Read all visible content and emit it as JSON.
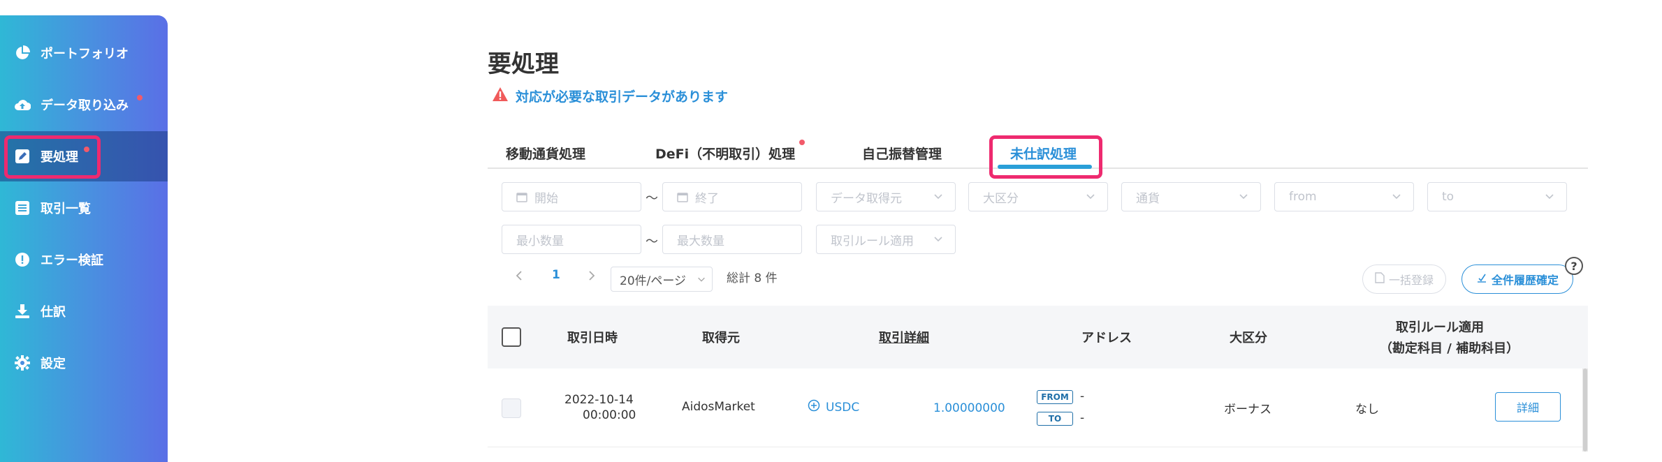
{
  "sidebar": {
    "items": [
      {
        "label": "ポートフォリオ",
        "icon": "pie-chart-icon"
      },
      {
        "label": "データ取り込み",
        "icon": "cloud-upload-icon",
        "dot": true
      },
      {
        "label": "要処理",
        "icon": "edit-icon",
        "dot": true,
        "active": true
      },
      {
        "label": "取引一覧",
        "icon": "list-icon"
      },
      {
        "label": "エラー検証",
        "icon": "alert-circle-icon"
      },
      {
        "label": "仕訳",
        "icon": "download-icon"
      },
      {
        "label": "設定",
        "icon": "gear-icon"
      }
    ]
  },
  "page": {
    "title": "要処理",
    "warning": "対応が必要な取引データがあります"
  },
  "tabs": [
    {
      "label": "移動通貨処理"
    },
    {
      "label": "DeFi（不明取引）処理",
      "dot": true
    },
    {
      "label": "自己振替管理"
    },
    {
      "label": "未仕訳処理",
      "active": true
    }
  ],
  "filters": {
    "start_placeholder": "開始",
    "tilde": "〜",
    "end_placeholder": "終了",
    "source_placeholder": "データ取得元",
    "category_placeholder": "大区分",
    "currency_placeholder": "通貨",
    "from_placeholder": "from",
    "to_placeholder": "to",
    "min_qty_placeholder": "最小数量",
    "max_qty_placeholder": "最大数量",
    "rule_placeholder": "取引ルール適用"
  },
  "pager": {
    "current_page": "1",
    "page_size": "20件/ページ",
    "total": "総計 8 件"
  },
  "actions": {
    "bulk_register": "一括登録",
    "confirm_all": "全件履歴確定",
    "help": "?"
  },
  "table": {
    "headers": {
      "datetime": "取引日時",
      "source": "取得元",
      "detail": "取引詳細",
      "address": "アドレス",
      "category": "大区分",
      "rule_line1": "取引ルール適用",
      "rule_line2": "（勘定科目 / 補助科目）"
    },
    "rows": [
      {
        "date": "2022-10-14",
        "time": "00:00:00",
        "source": "AidosMarket",
        "currency": "USDC",
        "amount": "1.00000000",
        "from_tag": "FROM",
        "from_value": "-",
        "to_tag": "TO",
        "to_value": "-",
        "category": "ボーナス",
        "rule": "なし",
        "detail_button": "詳細"
      }
    ]
  },
  "colors": {
    "accent": "#2a8fd8",
    "highlight": "#ee2a6f",
    "warning_icon": "#f05a5a",
    "dot": "#f25a6a"
  }
}
